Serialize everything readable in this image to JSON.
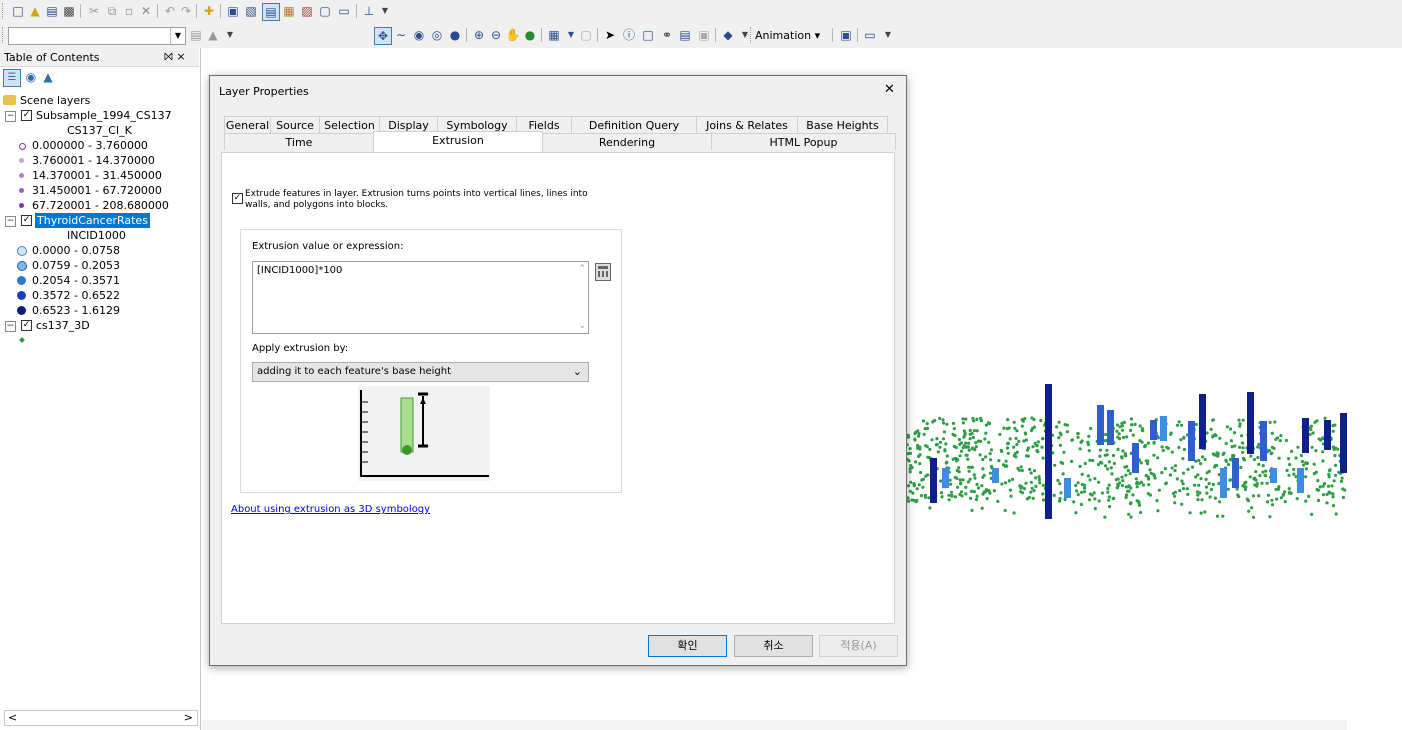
{
  "toolbar": {
    "animation_label": "Animation ▾"
  },
  "toc": {
    "title": "Table of Contents",
    "pin": "⨝ ×",
    "scene_layers": "Scene layers",
    "layers": [
      {
        "name": "Subsample_1994_CS137",
        "field": "CS137_CI_K",
        "classes": [
          "0.000000 - 3.760000",
          "3.760001 - 14.370000",
          "14.370001 - 31.450000",
          "31.450001 - 67.720000",
          "67.720001 - 208.680000"
        ],
        "colors": [
          "#d6c1e3",
          "#c7a6db",
          "#b07fcb",
          "#9a5cb9",
          "#7d3aa0"
        ]
      },
      {
        "name": "ThyroidCancerRates",
        "field": "INCID1000",
        "classes": [
          "0.0000 - 0.0758",
          "0.0759 - 0.2053",
          "0.2054 - 0.3571",
          "0.3572 - 0.6522",
          "0.6523 - 1.6129"
        ],
        "colors": [
          "#cfe6f5",
          "#7fb8e6",
          "#2e78d1",
          "#1f3fb0",
          "#121a7a"
        ]
      },
      {
        "name": "cs137_3D",
        "colors": [
          "#2a9a3a"
        ]
      }
    ]
  },
  "dialog": {
    "title": "Layer Properties",
    "close": "✕",
    "tabs_row1": [
      "General",
      "Source",
      "Selection",
      "Display",
      "Symbology",
      "Fields",
      "Definition Query",
      "Joins & Relates",
      "Base Heights"
    ],
    "tabs_row2": [
      "Time",
      "Extrusion",
      "Rendering",
      "HTML Popup"
    ],
    "active_tab": "Extrusion",
    "extrude_checkbox_label": "Extrude features in layer.  Extrusion turns points into vertical lines, lines into walls, and polygons into blocks.",
    "expression_label": "Extrusion value or expression:",
    "expression_value": "[INCID1000]*100",
    "apply_label": "Apply extrusion by:",
    "apply_value": "adding it to each feature's base height",
    "help_link": "About using extrusion as 3D symbology",
    "ok_button": "확인",
    "cancel_button": "취소",
    "apply_button": "적용(A)"
  },
  "colors": {
    "selected_bg": "#0078d7",
    "link": "#0000ee",
    "point_green": "#2e9e45",
    "bar_navy": "#0f1f8c",
    "bar_mid": "#2f5fcc",
    "bar_light": "#3d8ee0"
  }
}
